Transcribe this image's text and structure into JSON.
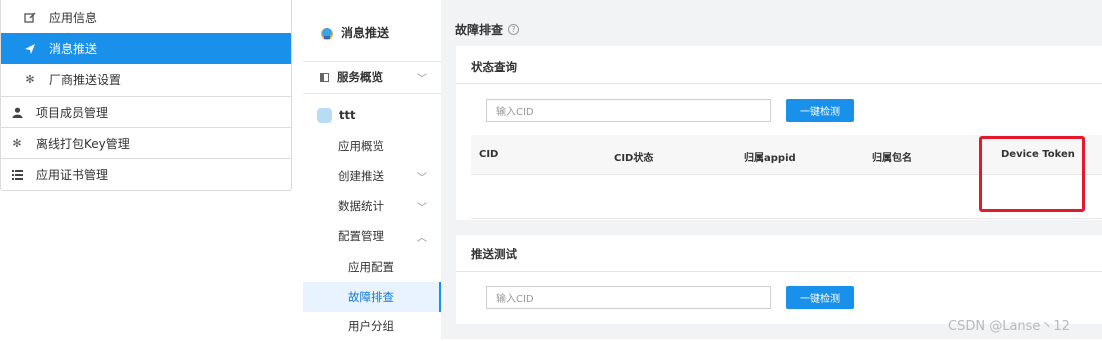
{
  "left_nav": {
    "items": [
      {
        "label": "应用信息",
        "icon": "edit-icon"
      },
      {
        "label": "消息推送",
        "icon": "send-icon",
        "active": true
      },
      {
        "label": "厂商推送设置",
        "icon": "gear-icon"
      },
      {
        "label": "项目成员管理",
        "icon": "user-icon"
      },
      {
        "label": "离线打包Key管理",
        "icon": "gear-icon"
      },
      {
        "label": "应用证书管理",
        "icon": "list-icon"
      }
    ]
  },
  "mid_menu": {
    "title": "消息推送",
    "overview": "服务概览",
    "app_name": "ttt",
    "items": [
      "应用概览",
      "创建推送",
      "数据统计",
      "配置管理",
      "应用配置",
      "故障排查",
      "用户分组"
    ]
  },
  "content": {
    "page_title": "故障排查",
    "status_panel": {
      "title": "状态查询",
      "input_placeholder": "输入CID",
      "button_label": "一键检测",
      "columns": [
        "CID",
        "CID状态",
        "归属appid",
        "归属包名",
        "Device Token"
      ]
    },
    "push_panel": {
      "title": "推送测试",
      "input_placeholder": "输入CID",
      "button_label": "一键检测"
    }
  },
  "watermark": "CSDN @Lanse丶12",
  "colors": {
    "accent": "#1991eb",
    "highlight_box": "#e5192c",
    "content_bg": "#f2f3f5"
  }
}
